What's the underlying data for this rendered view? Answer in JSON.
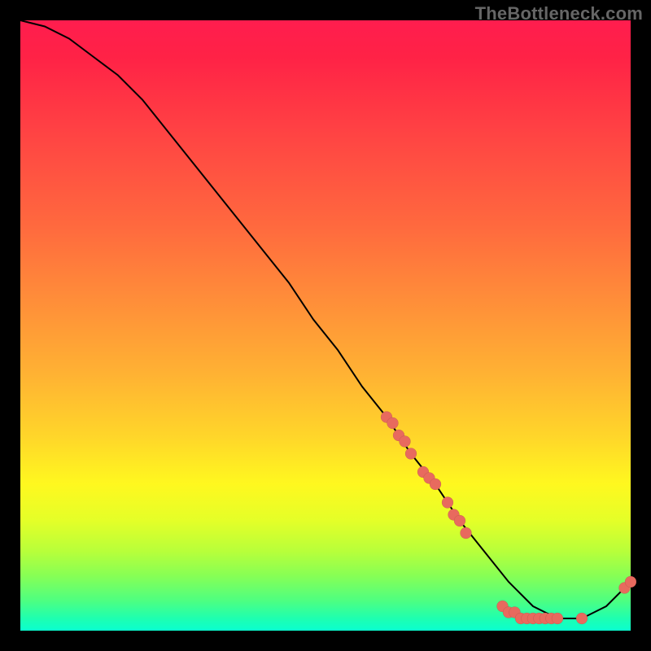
{
  "watermark": "TheBottleneck.com",
  "chart_data": {
    "type": "line",
    "title": "",
    "xlabel": "",
    "ylabel": "",
    "xlim": [
      0,
      100
    ],
    "ylim": [
      0,
      100
    ],
    "grid": false,
    "legend": false,
    "series": [
      {
        "name": "curve",
        "x": [
          0,
          4,
          8,
          12,
          16,
          20,
          24,
          28,
          32,
          36,
          40,
          44,
          48,
          52,
          56,
          60,
          64,
          68,
          72,
          76,
          80,
          82,
          84,
          86,
          88,
          90,
          92,
          94,
          96,
          98,
          100
        ],
        "y": [
          100,
          99,
          97,
          94,
          91,
          87,
          82,
          77,
          72,
          67,
          62,
          57,
          51,
          46,
          40,
          35,
          29,
          24,
          18,
          13,
          8,
          6,
          4,
          3,
          2,
          2,
          2,
          3,
          4,
          6,
          8
        ]
      }
    ],
    "points": [
      {
        "x": 60,
        "y": 35
      },
      {
        "x": 61,
        "y": 34
      },
      {
        "x": 62,
        "y": 32
      },
      {
        "x": 63,
        "y": 31
      },
      {
        "x": 64,
        "y": 29
      },
      {
        "x": 66,
        "y": 26
      },
      {
        "x": 67,
        "y": 25
      },
      {
        "x": 68,
        "y": 24
      },
      {
        "x": 70,
        "y": 21
      },
      {
        "x": 71,
        "y": 19
      },
      {
        "x": 72,
        "y": 18
      },
      {
        "x": 73,
        "y": 16
      },
      {
        "x": 79,
        "y": 4
      },
      {
        "x": 80,
        "y": 3
      },
      {
        "x": 81,
        "y": 3
      },
      {
        "x": 82,
        "y": 2
      },
      {
        "x": 83,
        "y": 2
      },
      {
        "x": 84,
        "y": 2
      },
      {
        "x": 85,
        "y": 2
      },
      {
        "x": 86,
        "y": 2
      },
      {
        "x": 87,
        "y": 2
      },
      {
        "x": 88,
        "y": 2
      },
      {
        "x": 92,
        "y": 2
      },
      {
        "x": 99,
        "y": 7
      },
      {
        "x": 100,
        "y": 8
      }
    ],
    "gradient_stops": [
      {
        "pos": 0.0,
        "color": "#ff1d4e"
      },
      {
        "pos": 0.2,
        "color": "#ff4743"
      },
      {
        "pos": 0.46,
        "color": "#ff8e39"
      },
      {
        "pos": 0.68,
        "color": "#ffd52a"
      },
      {
        "pos": 0.82,
        "color": "#e4ff28"
      },
      {
        "pos": 0.95,
        "color": "#4fff80"
      },
      {
        "pos": 1.0,
        "color": "#0affd0"
      }
    ]
  }
}
